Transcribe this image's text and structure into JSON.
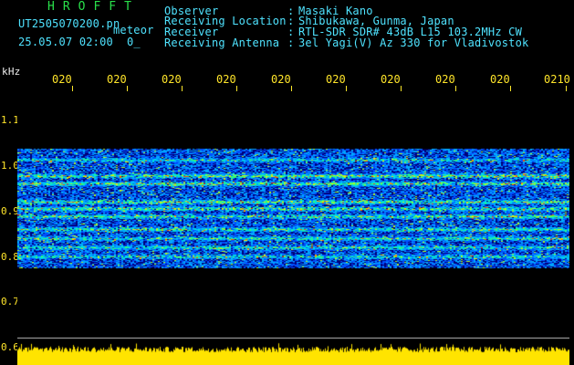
{
  "header": {
    "app_title": "HROFFT",
    "filename": "UT2505070200.pn",
    "suffix": "meteor",
    "datetime": "25.05.07 02:00",
    "tail": "0_",
    "info": [
      {
        "label": "Observer",
        "value": "Masaki Kano"
      },
      {
        "label": "Receiving Location",
        "value": "Shibukawa, Gunma, Japan"
      },
      {
        "label": "Receiver",
        "value": "RTL-SDR SDR# 43dB L15 103.2MHz CW"
      },
      {
        "label": "Receiving Antenna",
        "value": "3el Yagi(V) Az 330 for Vladivostok"
      }
    ],
    "colon": ":"
  },
  "axis": {
    "y_unit": "kHz",
    "y_ticks": [
      "1.1",
      "1.0",
      "0.9",
      "0.8",
      "0.7",
      "0.6"
    ],
    "x_ticks": [
      "020",
      "020",
      "020",
      "020",
      "020",
      "020",
      "020",
      "020",
      "020",
      "0210"
    ]
  },
  "colors": {
    "background": "#000000",
    "title": "#29e04a",
    "labels": "#4fe3ff",
    "axis": "#ffe52a",
    "noise_floor": "#ffe400",
    "spectrum_bg": "#00007a"
  },
  "spectrogram": {
    "time_range": [
      "02:00",
      "02:10"
    ],
    "freq_range_khz": [
      0.775,
      1.035
    ],
    "bright_band_khz": [
      0.977,
      0.96,
      0.92,
      0.905,
      0.888,
      0.86,
      0.84,
      0.82,
      0.8,
      1.012
    ]
  }
}
